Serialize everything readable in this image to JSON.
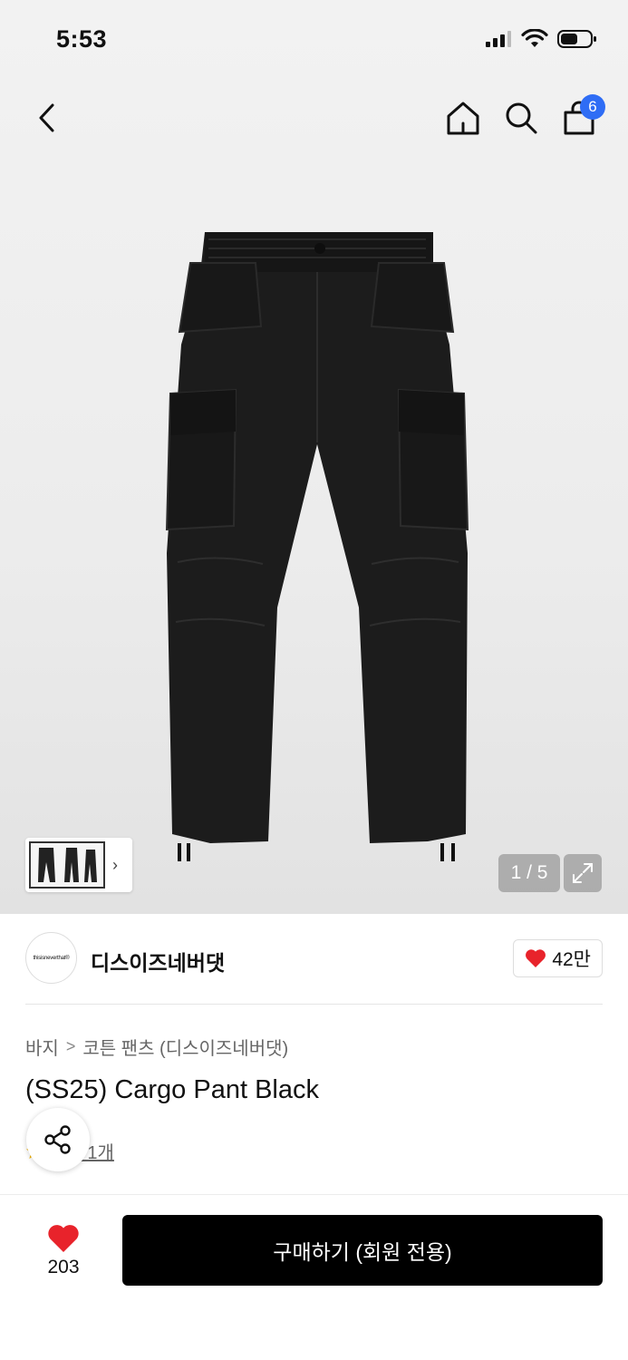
{
  "status_bar": {
    "time": "5:53"
  },
  "nav": {
    "cart_count": "6"
  },
  "gallery": {
    "page_counter": "1 / 5"
  },
  "brand": {
    "logo_text": "thisisneverthat®",
    "name": "디스이즈네버댓",
    "like_count": "42만"
  },
  "breadcrumb": {
    "level1": "바지",
    "level2": "코튼 팬츠 (디스이즈네버댓)"
  },
  "product": {
    "title": "(SS25) Cargo Pant Black",
    "review_text": "후기 1개"
  },
  "bottom_bar": {
    "wish_count": "203",
    "buy_label": "구매하기 (회원 전용)"
  },
  "colors": {
    "heart": "#e8232b",
    "badge": "#2f6df5",
    "buy_button": "#000000"
  }
}
